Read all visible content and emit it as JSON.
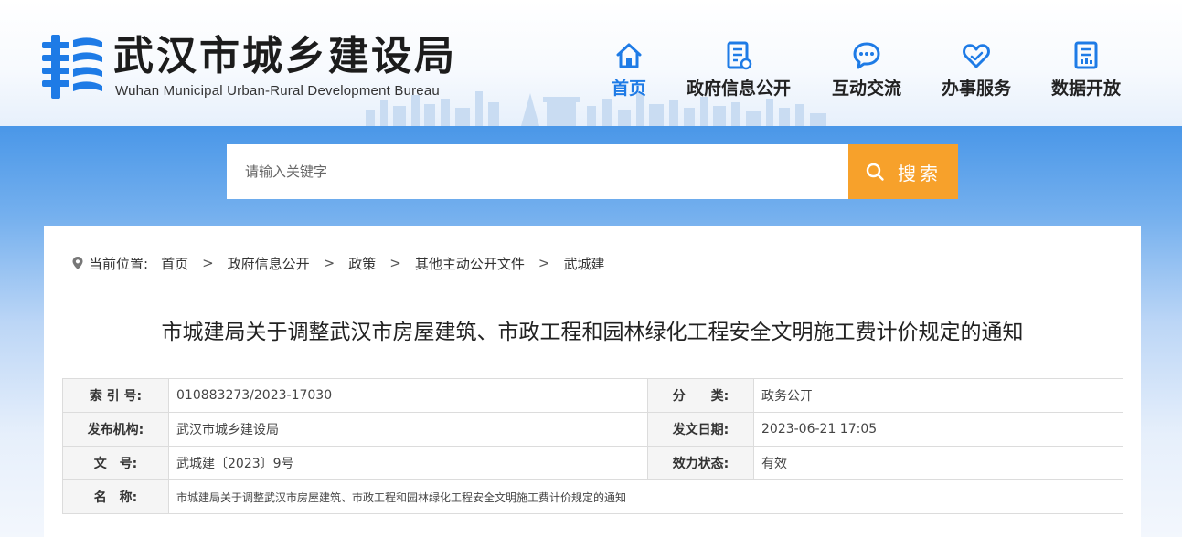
{
  "header": {
    "title_cn": "武汉市城乡建设局",
    "title_en": "Wuhan Municipal Urban-Rural Development Bureau"
  },
  "nav": [
    {
      "label": "首页",
      "icon": "home-icon",
      "active": true
    },
    {
      "label": "政府信息公开",
      "icon": "document-icon",
      "active": false
    },
    {
      "label": "互动交流",
      "icon": "chat-icon",
      "active": false
    },
    {
      "label": "办事服务",
      "icon": "heart-hand-icon",
      "active": false
    },
    {
      "label": "数据开放",
      "icon": "data-document-icon",
      "active": false
    }
  ],
  "search": {
    "placeholder": "请输入关键字",
    "button_label": "搜索",
    "button_color": "#f7a12b"
  },
  "breadcrumb": {
    "prefix": "当前位置:",
    "items": [
      "首页",
      "政府信息公开",
      "政策",
      "其他主动公开文件",
      "武城建"
    ],
    "separator": ">"
  },
  "document": {
    "title": "市城建局关于调整武汉市房屋建筑、市政工程和园林绿化工程安全文明施工费计价规定的通知",
    "meta": {
      "index_label": "索 引 号:",
      "index_value": "010883273/2023-17030",
      "category_label": "分　　类:",
      "category_value": "政务公开",
      "publisher_label": "发布机构:",
      "publisher_value": "武汉市城乡建设局",
      "date_label": "发文日期:",
      "date_value": "2023-06-21 17:05",
      "docno_label": "文　号:",
      "docno_value": "武城建〔2023〕9号",
      "status_label": "效力状态:",
      "status_value": "有效",
      "name_label": "名　称:",
      "name_value": "市城建局关于调整武汉市房屋建筑、市政工程和园林绿化工程安全文明施工费计价规定的通知"
    }
  },
  "colors": {
    "accent_blue": "#1e7be6",
    "search_orange": "#f7a12b"
  }
}
